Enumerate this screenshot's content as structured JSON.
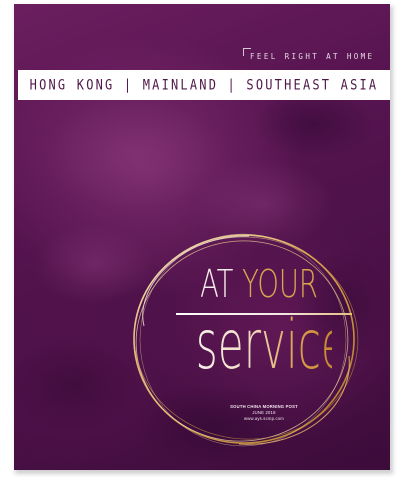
{
  "cover": {
    "tagline": "FEEL RIGHT AT HOME",
    "regions": "HONG KONG  |  MAINLAND  |  SOUTHEAST ASIA",
    "title_line1_part1": "AT",
    "title_line1_part2": "YOUR",
    "title_line2": "service",
    "publisher": "SOUTH CHINA MORNING POST",
    "date": "JUNE 2018",
    "website": "www.ays.scmp.com"
  },
  "colors": {
    "background_purple": "#561450",
    "accent_gold": "#d9a54e",
    "region_text": "#4f1748"
  }
}
